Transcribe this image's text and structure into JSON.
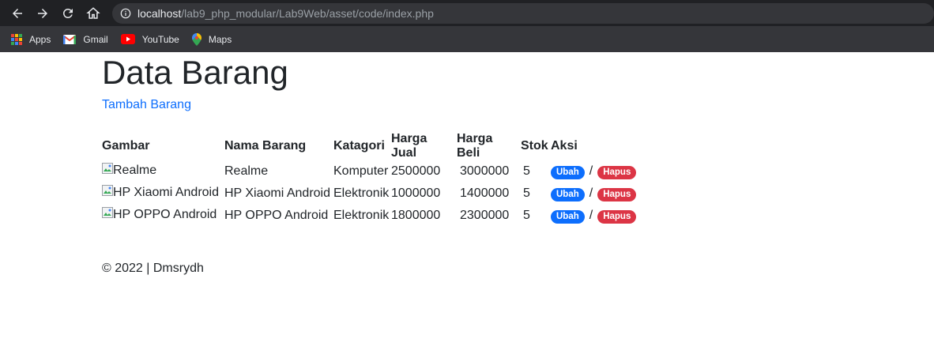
{
  "browser": {
    "url_host": "localhost",
    "url_path": "/lab9_php_modular/Lab9Web/asset/code/index.php",
    "bookmarks": [
      {
        "label": "Apps",
        "icon": "apps-icon"
      },
      {
        "label": "Gmail",
        "icon": "gmail-icon"
      },
      {
        "label": "YouTube",
        "icon": "youtube-icon"
      },
      {
        "label": "Maps",
        "icon": "maps-icon"
      }
    ]
  },
  "page": {
    "title": "Data Barang",
    "add_link": "Tambah Barang"
  },
  "table": {
    "headers": [
      "Gambar",
      "Nama Barang",
      "Katagori",
      "Harga Jual",
      "Harga Beli",
      "Stok",
      "Aksi"
    ],
    "rows": [
      {
        "gambar": "Realme",
        "nama": "Realme",
        "kategori": "Komputer",
        "harga_jual": "2500000",
        "harga_beli": "3000000",
        "stok": "5"
      },
      {
        "gambar": "HP Xiaomi Android",
        "nama": "HP Xiaomi Android",
        "kategori": "Elektronik",
        "harga_jual": "1000000",
        "harga_beli": "1400000",
        "stok": "5"
      },
      {
        "gambar": "HP OPPO Android",
        "nama": "HP OPPO Android",
        "kategori": "Elektronik",
        "harga_jual": "1800000",
        "harga_beli": "2300000",
        "stok": "5"
      }
    ],
    "action_edit": "Ubah",
    "action_separator": "/",
    "action_delete": "Hapus"
  },
  "footer": {
    "text": "© 2022 | Dmsrydh"
  },
  "colors": {
    "link": "#0d6efd",
    "edit_badge": "#0d6efd",
    "delete_badge": "#dc3545"
  }
}
